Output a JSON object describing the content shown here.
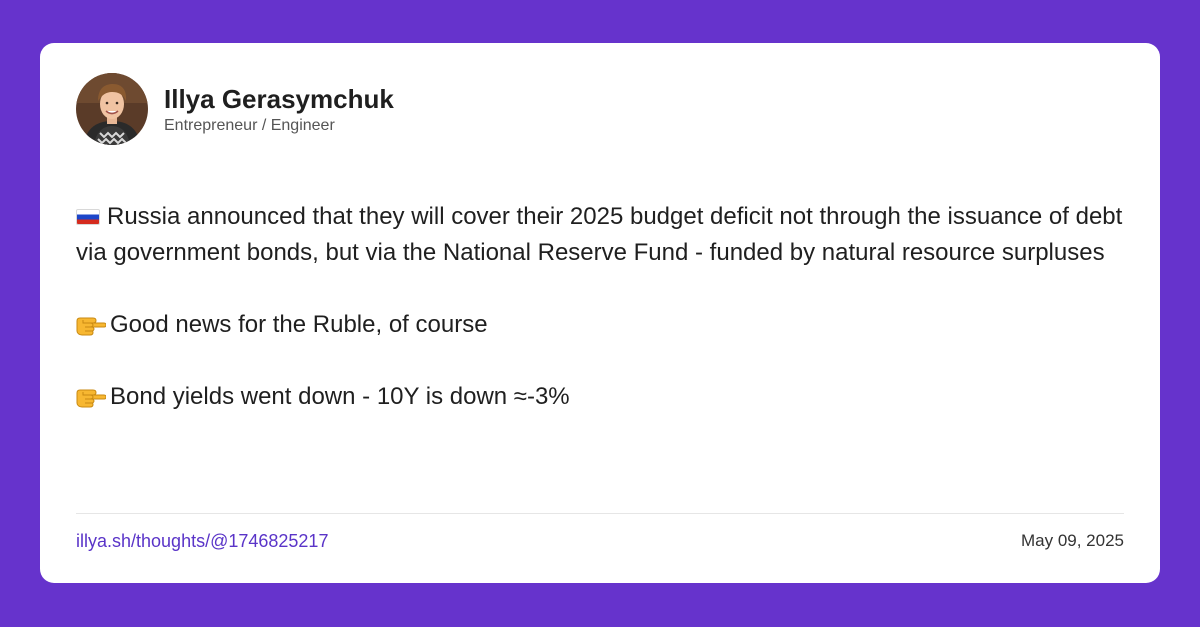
{
  "author": {
    "name": "Illya Gerasymchuk",
    "role": "Entrepreneur / Engineer",
    "avatar_icon": "profile-photo"
  },
  "post": {
    "paragraphs": [
      {
        "icon": "russia-flag-icon",
        "text": "Russia announced that they will cover their 2025 budget deficit not through the issuance of debt via government bonds, but via the National Reserve Fund - funded by natural resource surpluses"
      },
      {
        "icon": "pointing-hand-icon",
        "text": "Good news for the Ruble, of course"
      },
      {
        "icon": "pointing-hand-icon",
        "text": "Bond yields went down - 10Y is down ≈-3%"
      }
    ]
  },
  "footer": {
    "link": "illya.sh/thoughts/@1746825217",
    "date": "May 09, 2025"
  },
  "colors": {
    "background": "#6633cc",
    "card": "#ffffff",
    "link": "#5a34c8"
  }
}
